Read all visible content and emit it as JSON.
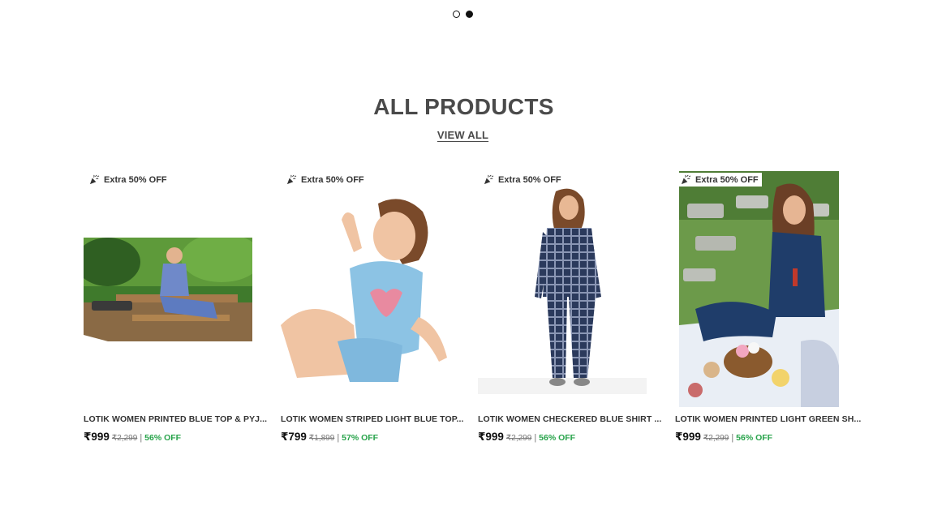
{
  "carousel": {
    "dot_count": 2,
    "active_index": 1
  },
  "section": {
    "title": "ALL PRODUCTS",
    "view_all_label": "VIEW ALL"
  },
  "colors": {
    "discount_green": "#27a34a",
    "text_dark": "#4a4a4a",
    "price_black": "#111111"
  },
  "products": [
    {
      "badge_icon": "party-popper-icon",
      "badge": "Extra 50% OFF",
      "title": "LOTIK WOMEN PRINTED BLUE TOP & PYJ...",
      "price": "₹999",
      "mrp": "₹2,299",
      "separator": "|",
      "discount": "56% OFF"
    },
    {
      "badge_icon": "party-popper-icon",
      "badge": "Extra 50% OFF",
      "title": "LOTIK WOMEN STRIPED LIGHT BLUE TOP...",
      "price": "₹799",
      "mrp": "₹1,899",
      "separator": "|",
      "discount": "57% OFF"
    },
    {
      "badge_icon": "party-popper-icon",
      "badge": "Extra 50% OFF",
      "title": "LOTIK WOMEN CHECKERED BLUE SHIRT ...",
      "price": "₹999",
      "mrp": "₹2,299",
      "separator": "|",
      "discount": "56% OFF"
    },
    {
      "badge_icon": "party-popper-icon",
      "badge": "Extra 50% OFF",
      "title": "LOTIK WOMEN PRINTED LIGHT GREEN SH...",
      "price": "₹999",
      "mrp": "₹2,299",
      "separator": "|",
      "discount": "56% OFF"
    }
  ]
}
